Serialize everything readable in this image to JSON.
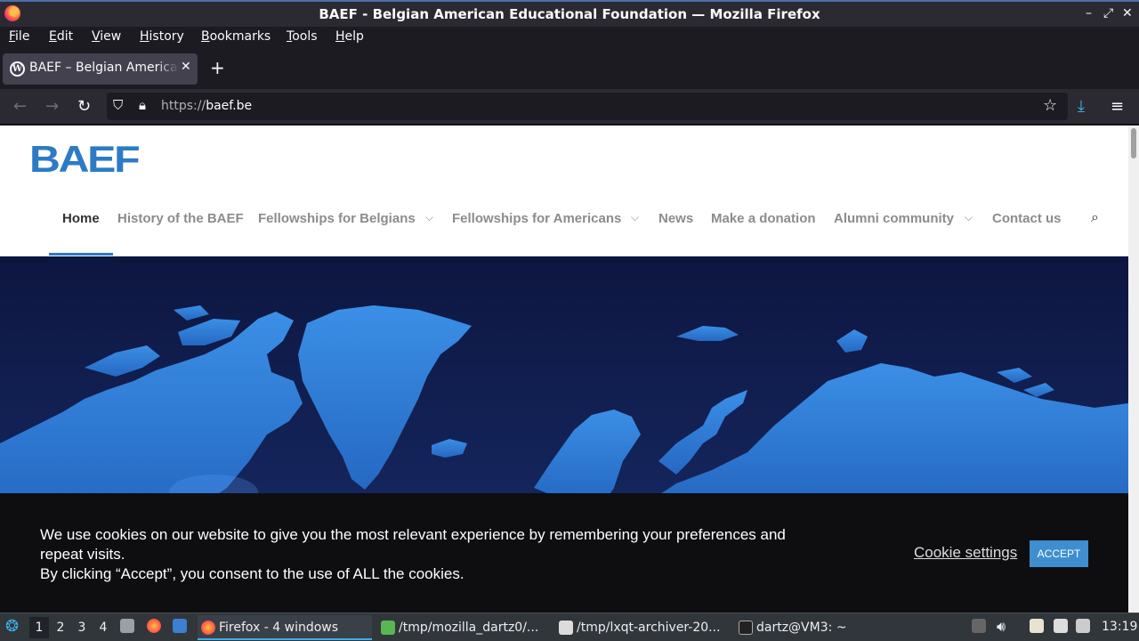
{
  "window": {
    "title": "BAEF - Belgian American Educational Foundation — Mozilla Firefox",
    "controls": [
      "–",
      "⤢",
      "✕"
    ]
  },
  "menubar": {
    "items": [
      "File",
      "Edit",
      "View",
      "History",
      "Bookmarks",
      "Tools",
      "Help"
    ]
  },
  "tabs": [
    {
      "label": "BAEF – Belgian American Educational Foundation",
      "favicon": "W",
      "close": "✕"
    }
  ],
  "newtab": "+",
  "navbar": {
    "back": "←",
    "forward": "→",
    "reload": "↻",
    "url_protocol": "https://",
    "url_host": "baef.be",
    "star": "☆",
    "download": "⤓",
    "menu": "≡"
  },
  "site": {
    "logo": "BAEF",
    "nav": [
      {
        "label": "Home"
      },
      {
        "label": "History of the BAEF"
      },
      {
        "label": "Fellowships for Belgians",
        "chevron": "⌵"
      },
      {
        "label": "Fellowships for Americans",
        "chevron": "⌵"
      },
      {
        "label": "News"
      },
      {
        "label": "Make a donation"
      },
      {
        "label": "Alumni community",
        "chevron": "⌵"
      },
      {
        "label": "Contact us"
      }
    ],
    "search_icon": "⌕"
  },
  "cookie": {
    "line1": "We use cookies on our website to give you the most relevant experience by remembering your preferences and repeat visits.",
    "line2": "By clicking “Accept”, you consent to the use of ALL the cookies.",
    "settings": "Cookie settings",
    "accept": "ACCEPT"
  },
  "taskbar": {
    "desktops": [
      "1",
      "2",
      "3",
      "4"
    ],
    "tasks": [
      "Firefox - 4 windows",
      "/tmp/mozilla_dartz0/...",
      "/tmp/lxqt-archiver-20...",
      "dartz@VM3: ~"
    ],
    "clock": "13:19"
  },
  "colors": {
    "accent": "#2d7bc4",
    "hero_dark": "#0d1640",
    "map_blue": "#2f7fd8",
    "accept_button": "#3e8ed0"
  }
}
